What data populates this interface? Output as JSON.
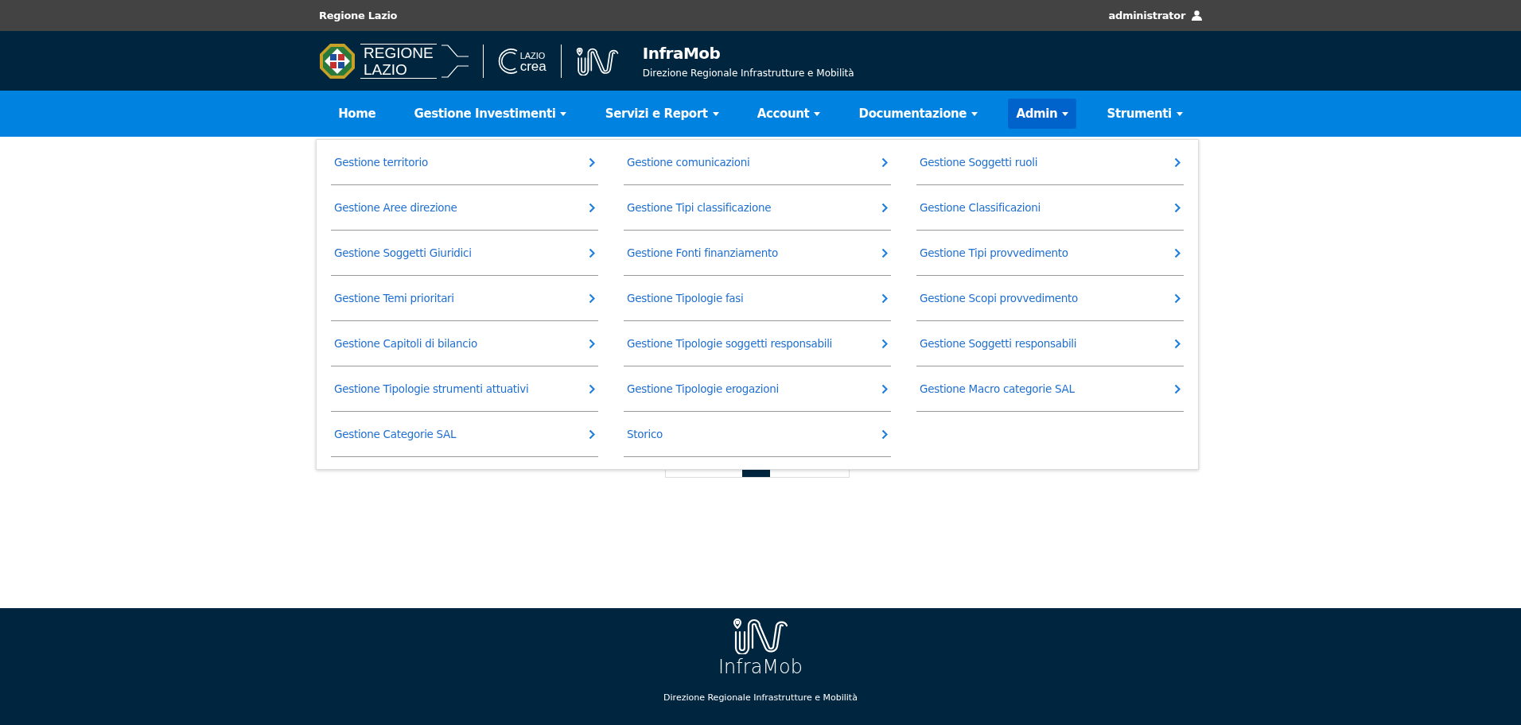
{
  "top_bar": {
    "title": "Regione Lazio",
    "user": "administrator"
  },
  "header": {
    "logo_regione": [
      "REGIONE",
      "LAZIO"
    ],
    "logo_laziocrea": [
      "LAZIO",
      "crea"
    ],
    "app_name": "InfraMob",
    "subtitle": "Direzione Regionale Infrastrutture e Mobilità"
  },
  "nav": [
    {
      "label": "Home",
      "dropdown": false,
      "selected": false
    },
    {
      "label": "Gestione Investimenti",
      "dropdown": true,
      "selected": false
    },
    {
      "label": "Servizi e Report",
      "dropdown": true,
      "selected": false
    },
    {
      "label": "Account",
      "dropdown": true,
      "selected": false
    },
    {
      "label": "Documentazione",
      "dropdown": true,
      "selected": false
    },
    {
      "label": "Admin",
      "dropdown": true,
      "selected": true
    },
    {
      "label": "Strumenti",
      "dropdown": true,
      "selected": false
    }
  ],
  "admin_menu": [
    [
      "Gestione territorio",
      "Gestione Aree direzione",
      "Gestione Soggetti Giuridici",
      "Gestione Temi prioritari",
      "Gestione Capitoli di bilancio",
      "Gestione Tipologie strumenti attuativi",
      "Gestione Categorie SAL"
    ],
    [
      "Gestione comunicazioni",
      "Gestione Tipi classificazione",
      "Gestione Fonti finanziamento",
      "Gestione Tipologie fasi",
      "Gestione Tipologie soggetti responsabili",
      "Gestione Tipologie erogazioni",
      "Storico"
    ],
    [
      "Gestione Soggetti ruoli",
      "Gestione Classificazioni",
      "Gestione Tipi provvedimento",
      "Gestione Scopi provvedimento",
      "Gestione Soggetti responsabili",
      "Gestione Macro categorie SAL"
    ]
  ],
  "footer": {
    "app_name": "InfraMob",
    "subtitle": "Direzione Regionale Infrastrutture e Mobilità"
  }
}
